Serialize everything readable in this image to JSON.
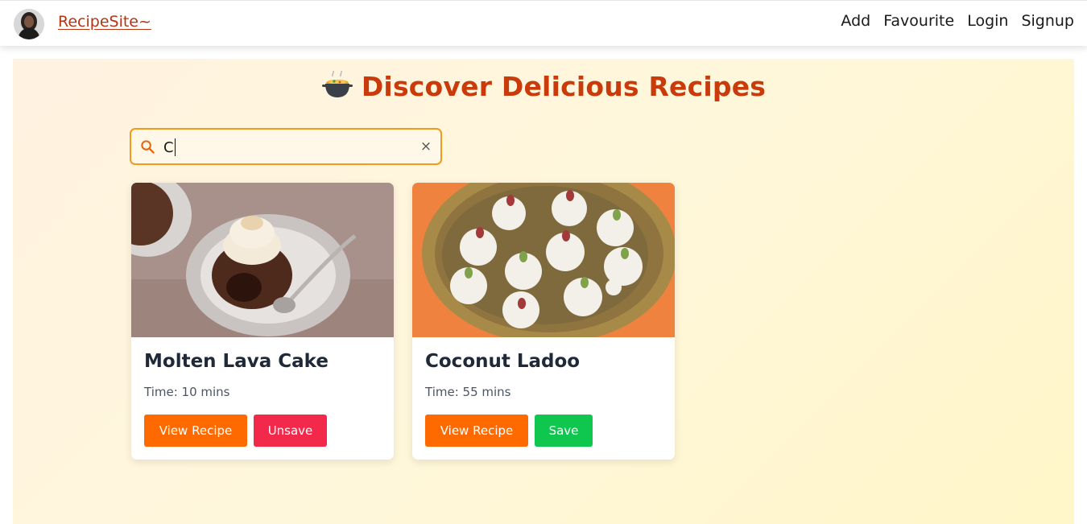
{
  "navbar": {
    "brand": "RecipeSite~",
    "links": [
      "Add",
      "Favourite",
      "Login",
      "Signup"
    ]
  },
  "main": {
    "title": "Discover Delicious Recipes",
    "title_icon": "curry-pot-icon"
  },
  "search": {
    "value": "C",
    "icon": "search-icon",
    "clear_icon": "close-icon",
    "clear_glyph": "×"
  },
  "recipes": [
    {
      "title": "Molten Lava Cake",
      "time": "Time: 10 mins",
      "view_label": "View Recipe",
      "action_label": "Unsave"
    },
    {
      "title": "Coconut Ladoo",
      "time": "Time: 55 mins",
      "view_label": "View Recipe",
      "action_label": "Save"
    }
  ],
  "colors": {
    "brand": "#b8330f",
    "title": "#c93b0a",
    "search_border": "#f29a1a",
    "view_button": "#ff6a00",
    "unsave_button": "#f2294a",
    "save_button": "#0fc64e"
  }
}
